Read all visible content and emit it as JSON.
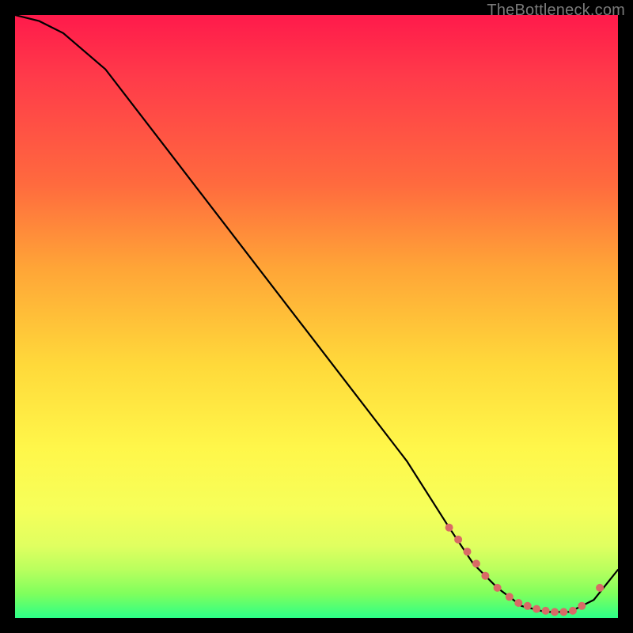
{
  "watermark": "TheBottleneck.com",
  "colors": {
    "frame_bg": "#000000",
    "curve_stroke": "#000000",
    "dot_fill": "#d96a66",
    "gradient_top": "#ff1a4b",
    "gradient_mid": "#ffd93a",
    "gradient_bottom": "#2cff87"
  },
  "chart_data": {
    "type": "line",
    "title": "",
    "xlabel": "",
    "ylabel": "",
    "xlim": [
      0,
      100
    ],
    "ylim": [
      0,
      100
    ],
    "x": [
      0,
      4,
      8,
      15,
      25,
      35,
      45,
      55,
      65,
      72,
      76,
      80,
      84,
      88,
      92,
      96,
      100
    ],
    "values": [
      100,
      99,
      97,
      91,
      78,
      65,
      52,
      39,
      26,
      15,
      9,
      5,
      2,
      1,
      1,
      3,
      8
    ],
    "annotation": "Curve descends steeply from top-left, bottoms out near x≈85–92, then rises slightly at right edge.",
    "dots": [
      {
        "x": 72,
        "y": 15
      },
      {
        "x": 73.5,
        "y": 13
      },
      {
        "x": 75,
        "y": 11
      },
      {
        "x": 76.5,
        "y": 9
      },
      {
        "x": 78,
        "y": 7
      },
      {
        "x": 80,
        "y": 5
      },
      {
        "x": 82,
        "y": 3.5
      },
      {
        "x": 83.5,
        "y": 2.5
      },
      {
        "x": 85,
        "y": 2
      },
      {
        "x": 86.5,
        "y": 1.5
      },
      {
        "x": 88,
        "y": 1.2
      },
      {
        "x": 89.5,
        "y": 1
      },
      {
        "x": 91,
        "y": 1
      },
      {
        "x": 92.5,
        "y": 1.2
      },
      {
        "x": 94,
        "y": 2
      },
      {
        "x": 97,
        "y": 5
      }
    ]
  }
}
